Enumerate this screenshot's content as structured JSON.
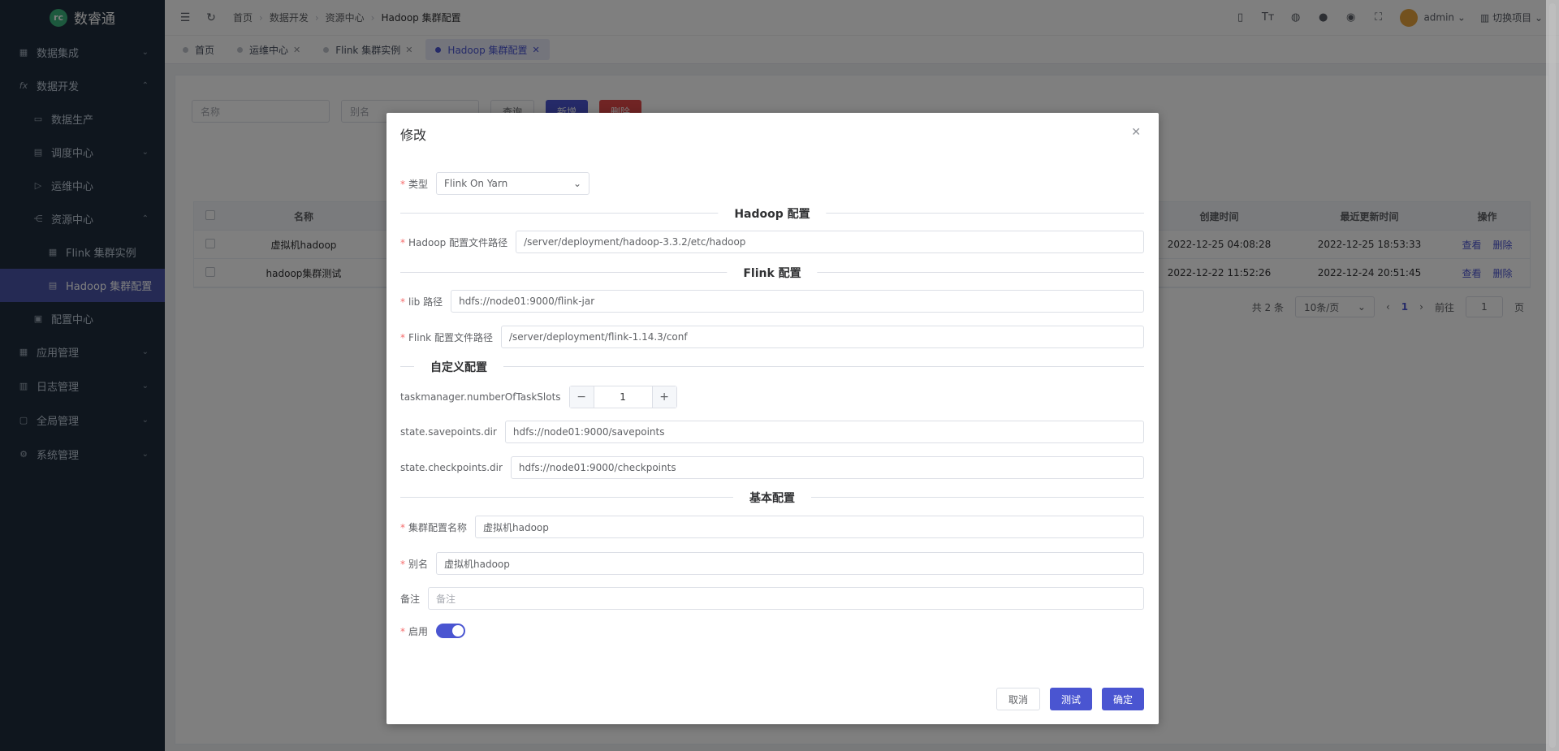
{
  "app": {
    "name": "数睿通"
  },
  "sidebar": {
    "items": [
      {
        "label": "数据集成",
        "icon": "database-icon"
      },
      {
        "label": "数据开发",
        "icon": "fx-icon"
      },
      {
        "label": "数据生产",
        "icon": "monitor-icon"
      },
      {
        "label": "调度中心",
        "icon": "calendar-icon"
      },
      {
        "label": "运维中心",
        "icon": "send-icon"
      },
      {
        "label": "资源中心",
        "icon": "share-icon"
      },
      {
        "label": "Flink 集群实例",
        "icon": "grid-icon"
      },
      {
        "label": "Hadoop 集群配置",
        "icon": "table-icon"
      },
      {
        "label": "配置中心",
        "icon": "settings-box-icon"
      },
      {
        "label": "应用管理",
        "icon": "apps-icon"
      },
      {
        "label": "日志管理",
        "icon": "log-icon"
      },
      {
        "label": "全局管理",
        "icon": "global-icon"
      },
      {
        "label": "系统管理",
        "icon": "gear-icon"
      }
    ]
  },
  "header": {
    "breadcrumbs": [
      "首页",
      "数据开发",
      "资源中心",
      "Hadoop 集群配置"
    ],
    "user": "admin",
    "switch_project": "切换项目"
  },
  "tabs": [
    {
      "label": "首页"
    },
    {
      "label": "运维中心"
    },
    {
      "label": "Flink 集群实例"
    },
    {
      "label": "Hadoop 集群配置"
    }
  ],
  "toolbar": {
    "name_placeholder": "名称",
    "alias_placeholder": "别名",
    "query": "查询",
    "add": "新增",
    "delete": "删除"
  },
  "table": {
    "columns": [
      "名称",
      "创建时间",
      "最近更新时间",
      "操作"
    ],
    "rows": [
      {
        "name": "虚拟机hadoop",
        "created": "2022-12-25 04:08:28",
        "updated": "2022-12-25 18:53:33"
      },
      {
        "name": "hadoop集群测试",
        "created": "2022-12-22 11:52:26",
        "updated": "2022-12-24 20:51:45"
      }
    ],
    "actions": {
      "view": "查看",
      "delete": "删除"
    }
  },
  "pagination": {
    "total": "共 2 条",
    "page_size": "10条/页",
    "current": "1",
    "goto": "前往",
    "goto_value": "1",
    "page_suffix": "页"
  },
  "modal": {
    "title": "修改",
    "type_label": "类型",
    "type_value": "Flink On Yarn",
    "section_hadoop": "Hadoop 配置",
    "hadoop_conf_label": "Hadoop 配置文件路径",
    "hadoop_conf_value": "/server/deployment/hadoop-3.3.2/etc/hadoop",
    "section_flink": "Flink 配置",
    "lib_label": "lib 路径",
    "lib_value": "hdfs://node01:9000/flink-jar",
    "flink_conf_label": "Flink 配置文件路径",
    "flink_conf_value": "/server/deployment/flink-1.14.3/conf",
    "section_custom": "自定义配置",
    "slots_label": "taskmanager.numberOfTaskSlots",
    "slots_value": "1",
    "savepoints_label": "state.savepoints.dir",
    "savepoints_value": "hdfs://node01:9000/savepoints",
    "checkpoints_label": "state.checkpoints.dir",
    "checkpoints_value": "hdfs://node01:9000/checkpoints",
    "section_basic": "基本配置",
    "cluster_name_label": "集群配置名称",
    "cluster_name_value": "虚拟机hadoop",
    "alias_label": "别名",
    "alias_value": "虚拟机hadoop",
    "note_label": "备注",
    "note_placeholder": "备注",
    "enable_label": "启用",
    "enabled": true,
    "cancel": "取消",
    "test": "测试",
    "confirm": "确定"
  },
  "colors": {
    "primary": "#4a55d1",
    "danger": "#e04848",
    "sidebar": "#1f2d3d"
  }
}
